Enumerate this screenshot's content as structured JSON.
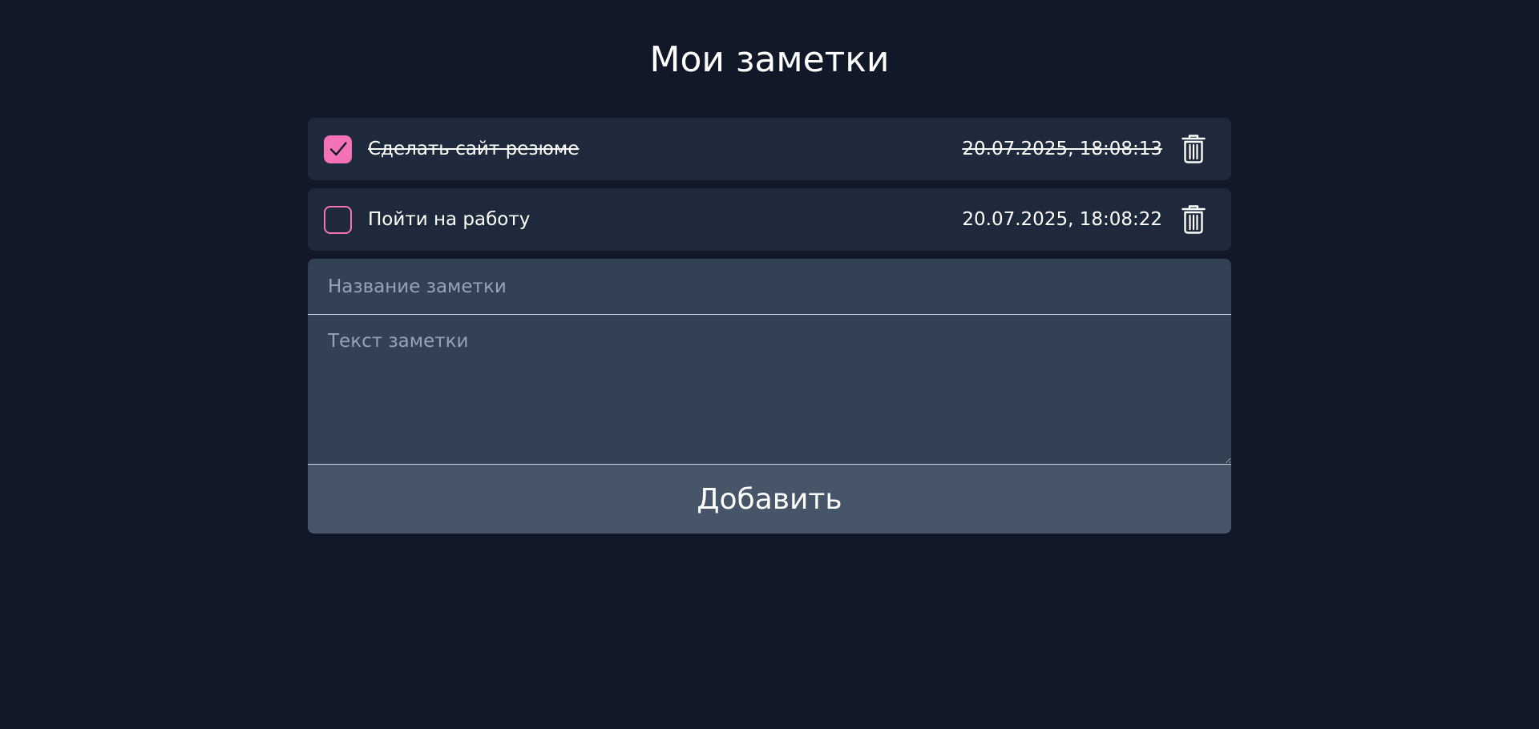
{
  "page": {
    "title": "Мои заметки"
  },
  "notes": [
    {
      "title": "Сделать сайт резюме",
      "date": "20.07.2025, 18:08:13",
      "checked": true
    },
    {
      "title": "Пойти на работу",
      "date": "20.07.2025, 18:08:22",
      "checked": false
    }
  ],
  "form": {
    "title_placeholder": "Название заметки",
    "text_placeholder": "Текст заметки",
    "add_label": "Добавить"
  },
  "icons": {
    "checkbox": "check-icon",
    "delete": "trash-icon"
  },
  "colors": {
    "background": "#111827",
    "note_background": "#1e293b",
    "form_background": "#334155",
    "button_background": "#475569",
    "accent": "#f472b6",
    "placeholder": "#94a3b8"
  }
}
